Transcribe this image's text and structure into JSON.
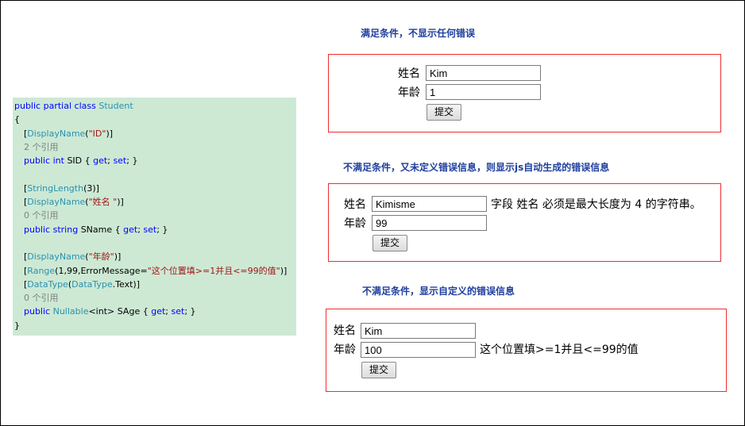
{
  "code": {
    "line1_public": "public",
    "line1_partial": "partial",
    "line1_class": "class",
    "line1_name": "Student",
    "open_brace": "{",
    "close_brace": "}",
    "attr_displayname": "DisplayName",
    "attr_id_value": "\"ID\"",
    "refs": "2 个引用",
    "refs0": "0 个引用",
    "kw_public": "public",
    "kw_int": "int",
    "kw_string": "string",
    "kw_get": "get",
    "kw_set": "set",
    "sid": "SID",
    "sname": "SName",
    "sage": "SAge",
    "attr_stringlength": "StringLength",
    "stringlength_arg": "(3)",
    "attr_name_value": "\"姓名 \"",
    "attr_age_value": "\"年龄\"",
    "attr_range": "Range",
    "range_args": "(1,99,ErrorMessage=",
    "range_msg": "\"这个位置填>=1并且<=99的值\"",
    "range_close": ")]",
    "attr_datatype": "DataType",
    "datatype_type": "DataType",
    "datatype_member": ".Text)]",
    "nullable": "Nullable",
    "nullable_arg": "<int>"
  },
  "captions": {
    "c1": "满足条件，不显示任何错误",
    "c2": "不满足条件，又未定义错误信息，则显示js自动生成的错误信息",
    "c3": "不满足条件，显示自定义的错误信息"
  },
  "form1": {
    "name_label": "姓名",
    "age_label": "年龄",
    "name_value": "Kim",
    "age_value": "1",
    "submit": "提交"
  },
  "form2": {
    "name_label": "姓名",
    "age_label": "年龄",
    "name_value": "Kimisme",
    "age_value": "99",
    "submit": "提交",
    "name_error": "字段 姓名 必须是最大长度为 4 的字符串。"
  },
  "form3": {
    "name_label": "姓名",
    "age_label": "年龄",
    "name_value": "Kim",
    "age_value": "100",
    "submit": "提交",
    "age_error": "这个位置填>=1并且<=99的值"
  },
  "colors": {
    "caption": "#1f3f9e",
    "box_border": "#ee2e2e",
    "code_bg": "#cde9d4",
    "keyword": "#0000ff",
    "type": "#2b91af",
    "string": "#a31515",
    "comment": "#808080"
  }
}
